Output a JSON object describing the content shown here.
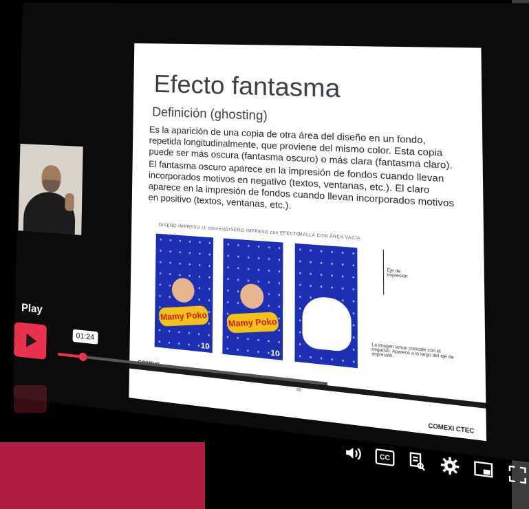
{
  "player": {
    "play_label": "Play",
    "time": "01:24",
    "progress_fraction": 0.1
  },
  "slide": {
    "title": "Efecto fantasma",
    "subtitle": "Definición (ghosting)",
    "paragraphs": [
      "Es la aparición de una copia de otra área del diseño en un fondo, repetida longitudinalmente, que proviene del mismo color. Esta copia puede ser más oscura (fantasma oscuro) o más clara (fantasma claro).",
      "El fantasma oscuro aparece en la impresión de fondos cuando llevan incorporados motivos en negativo (textos, ventanas, etc.). El claro aparece en la impresión de fondos cuando llevan incorporados motivos en positivo (textos, ventanas, etc.)."
    ],
    "captions": [
      "DISEÑO IMPRESO (1 colores)",
      "DISEÑO IMPRESO con EFECTO",
      "MALLA CON ÁREA VACÍA"
    ],
    "product_logo": "Mamy Poko",
    "size_label": "10",
    "axis_label": "Eje de impresión",
    "note": "La imagen tenue coincide con el negativo. Aparece a lo largo del eje de impresión.",
    "footer_brand": "COMEXI",
    "footer_brand_right": "COMEXI CTEC",
    "page_number": "48"
  },
  "controls": {
    "volume_icon": "volume-icon",
    "cc_label": "CC",
    "transcript_icon": "transcript-icon",
    "settings_icon": "gear-icon",
    "pip_icon": "pip-icon",
    "fullscreen_icon": "fullscreen-icon"
  },
  "colors": {
    "accent": "#e8324f",
    "panel_blue": "#1d2fb3",
    "bottom_block": "#b01e44",
    "right_panel": "#3d3d3d"
  }
}
